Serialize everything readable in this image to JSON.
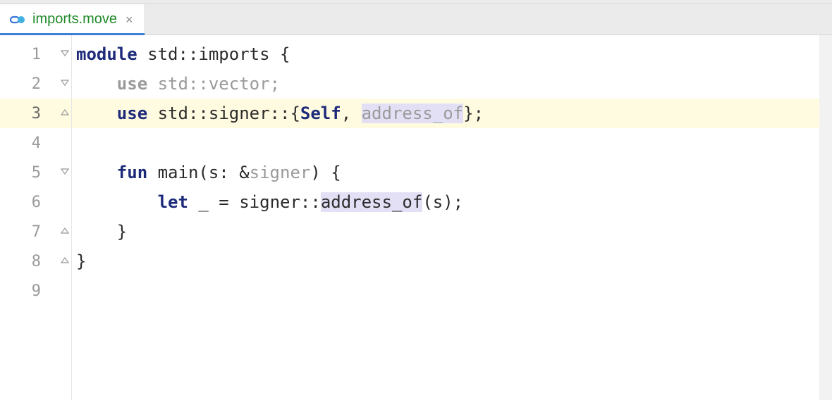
{
  "tab": {
    "label": "imports.move",
    "close_glyph": "×"
  },
  "lines": {
    "nums": [
      "1",
      "2",
      "3",
      "4",
      "5",
      "6",
      "7",
      "8",
      "9"
    ],
    "l1": {
      "module": "module",
      "path": "std::imports",
      "brace": "{"
    },
    "l2": {
      "use": "use",
      "path": "std::vector",
      "semi": ";"
    },
    "l3": {
      "use": "use",
      "path": "std::signer::",
      "open": "{",
      "self": "Self",
      "comma": ", ",
      "addr": "address_of",
      "close": "}",
      "semi": ";"
    },
    "l5": {
      "fun": "fun",
      "name": "main",
      "open": "(",
      "arg": "s: &",
      "type": "signer",
      "close": ") ",
      "brace": "{"
    },
    "l6": {
      "let": "let",
      "us": "_",
      "eq": " = ",
      "ns": "signer::",
      "fn": "address_of",
      "args": "(s)",
      "semi": ";"
    },
    "l7": {
      "brace": "}"
    },
    "l8": {
      "brace": "}"
    }
  }
}
